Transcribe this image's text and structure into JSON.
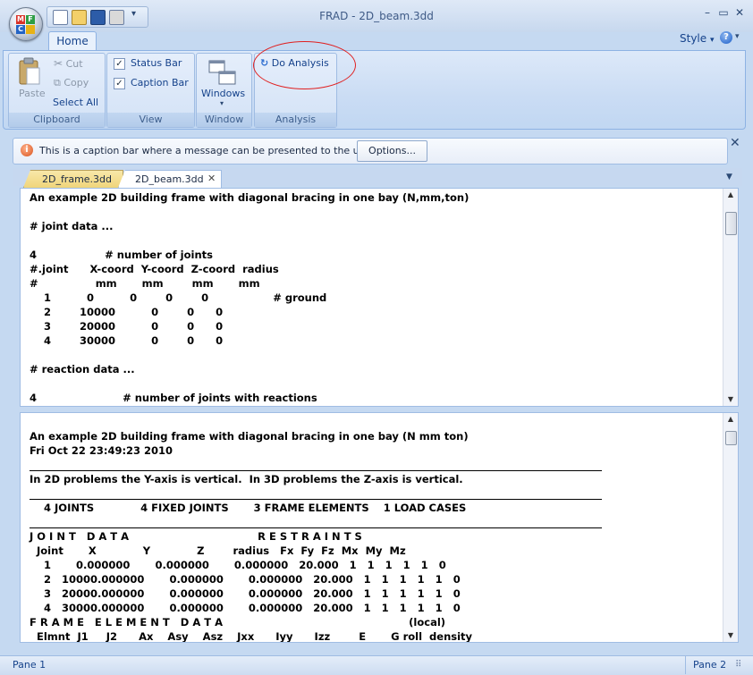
{
  "window": {
    "title": "FRAD - 2D_beam.3dd",
    "minimize": "–",
    "maximize": "▭",
    "close": "✕"
  },
  "ribbon": {
    "tab": "Home",
    "style_menu": "Style",
    "groups": {
      "clipboard": {
        "label": "Clipboard",
        "paste": "Paste",
        "cut": "Cut",
        "copy": "Copy",
        "select_all": "Select All"
      },
      "view": {
        "label": "View",
        "status_bar": "Status Bar",
        "caption_bar": "Caption Bar"
      },
      "window": {
        "label": "Window",
        "windows": "Windows"
      },
      "analysis": {
        "label": "Analysis",
        "do_analysis": "Do Analysis"
      }
    }
  },
  "caption_bar": {
    "message": "This is a caption bar where a message can be presented to the user.",
    "options": "Options..."
  },
  "doc_tabs": [
    "2D_frame.3dd",
    "2D_beam.3dd"
  ],
  "input_text": [
    "An example 2D building frame with diagonal bracing in one bay (N,mm,ton)",
    "",
    "# joint data ...",
    "",
    "4                   # number of joints",
    "#.joint      X-coord  Y-coord  Z-coord  radius",
    "#                mm       mm        mm       mm",
    "    1          0          0        0        0                  # ground",
    "    2        10000          0        0      0",
    "    3        20000          0        0      0",
    "    4        30000          0        0      0",
    "",
    "# reaction data ...",
    "",
    "4                        # number of joints with reactions"
  ],
  "output_text": {
    "l1": "An example 2D building frame with diagonal bracing in one bay (N mm ton)",
    "l2": "Fri Oct 22 23:49:23 2010",
    "l3": "In 2D problems the Y-axis is vertical.  In 3D problems the Z-axis is vertical.",
    "l4": "    4 JOINTS             4 FIXED JOINTS       3 FRAME ELEMENTS    1 LOAD CASES",
    "l5": "J O I N T   D A T A                                    R E S T R A I N T S",
    "l6": "  Joint       X             Y             Z        radius   Fx  Fy  Fz  Mx  My  Mz",
    "l7": "    1       0.000000       0.000000       0.000000   20.000   1   1   1   1   1   0",
    "l8": "    2   10000.000000       0.000000       0.000000   20.000   1   1   1   1   1   0",
    "l9": "    3   20000.000000       0.000000       0.000000   20.000   1   1   1   1   1   0",
    "l10": "    4   30000.000000       0.000000       0.000000   20.000   1   1   1   1   1   0",
    "l11": "F R A M E   E L E M E N T   D A T A                                                    (local)",
    "l12": "  Elmnt  J1     J2      Ax    Asy    Asz    Jxx      Iyy      Izz        E       G roll  density"
  },
  "status": {
    "pane1": "Pane 1",
    "pane2": "Pane 2"
  }
}
